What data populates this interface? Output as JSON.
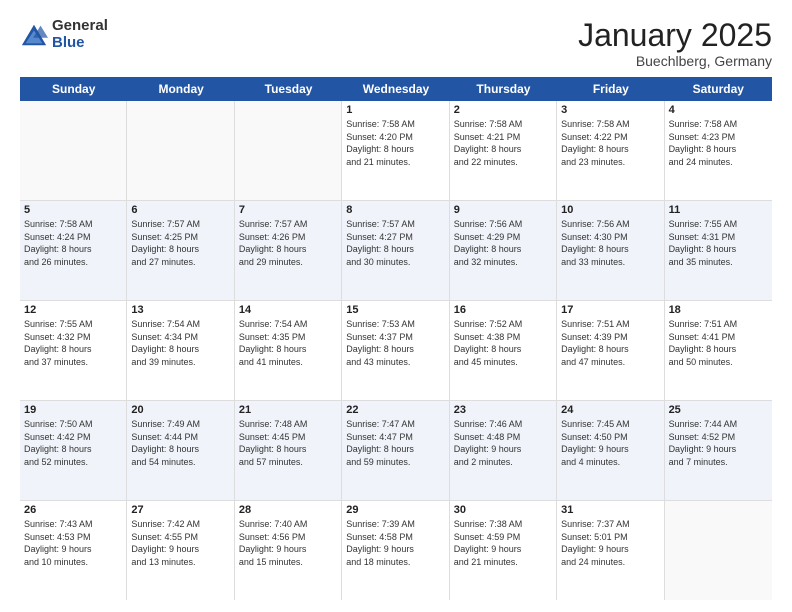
{
  "logo": {
    "general": "General",
    "blue": "Blue"
  },
  "title": "January 2025",
  "location": "Buechlberg, Germany",
  "header_days": [
    "Sunday",
    "Monday",
    "Tuesday",
    "Wednesday",
    "Thursday",
    "Friday",
    "Saturday"
  ],
  "rows": [
    {
      "alt": false,
      "cells": [
        {
          "day": "",
          "info": ""
        },
        {
          "day": "",
          "info": ""
        },
        {
          "day": "",
          "info": ""
        },
        {
          "day": "1",
          "info": "Sunrise: 7:58 AM\nSunset: 4:20 PM\nDaylight: 8 hours\nand 21 minutes."
        },
        {
          "day": "2",
          "info": "Sunrise: 7:58 AM\nSunset: 4:21 PM\nDaylight: 8 hours\nand 22 minutes."
        },
        {
          "day": "3",
          "info": "Sunrise: 7:58 AM\nSunset: 4:22 PM\nDaylight: 8 hours\nand 23 minutes."
        },
        {
          "day": "4",
          "info": "Sunrise: 7:58 AM\nSunset: 4:23 PM\nDaylight: 8 hours\nand 24 minutes."
        }
      ]
    },
    {
      "alt": true,
      "cells": [
        {
          "day": "5",
          "info": "Sunrise: 7:58 AM\nSunset: 4:24 PM\nDaylight: 8 hours\nand 26 minutes."
        },
        {
          "day": "6",
          "info": "Sunrise: 7:57 AM\nSunset: 4:25 PM\nDaylight: 8 hours\nand 27 minutes."
        },
        {
          "day": "7",
          "info": "Sunrise: 7:57 AM\nSunset: 4:26 PM\nDaylight: 8 hours\nand 29 minutes."
        },
        {
          "day": "8",
          "info": "Sunrise: 7:57 AM\nSunset: 4:27 PM\nDaylight: 8 hours\nand 30 minutes."
        },
        {
          "day": "9",
          "info": "Sunrise: 7:56 AM\nSunset: 4:29 PM\nDaylight: 8 hours\nand 32 minutes."
        },
        {
          "day": "10",
          "info": "Sunrise: 7:56 AM\nSunset: 4:30 PM\nDaylight: 8 hours\nand 33 minutes."
        },
        {
          "day": "11",
          "info": "Sunrise: 7:55 AM\nSunset: 4:31 PM\nDaylight: 8 hours\nand 35 minutes."
        }
      ]
    },
    {
      "alt": false,
      "cells": [
        {
          "day": "12",
          "info": "Sunrise: 7:55 AM\nSunset: 4:32 PM\nDaylight: 8 hours\nand 37 minutes."
        },
        {
          "day": "13",
          "info": "Sunrise: 7:54 AM\nSunset: 4:34 PM\nDaylight: 8 hours\nand 39 minutes."
        },
        {
          "day": "14",
          "info": "Sunrise: 7:54 AM\nSunset: 4:35 PM\nDaylight: 8 hours\nand 41 minutes."
        },
        {
          "day": "15",
          "info": "Sunrise: 7:53 AM\nSunset: 4:37 PM\nDaylight: 8 hours\nand 43 minutes."
        },
        {
          "day": "16",
          "info": "Sunrise: 7:52 AM\nSunset: 4:38 PM\nDaylight: 8 hours\nand 45 minutes."
        },
        {
          "day": "17",
          "info": "Sunrise: 7:51 AM\nSunset: 4:39 PM\nDaylight: 8 hours\nand 47 minutes."
        },
        {
          "day": "18",
          "info": "Sunrise: 7:51 AM\nSunset: 4:41 PM\nDaylight: 8 hours\nand 50 minutes."
        }
      ]
    },
    {
      "alt": true,
      "cells": [
        {
          "day": "19",
          "info": "Sunrise: 7:50 AM\nSunset: 4:42 PM\nDaylight: 8 hours\nand 52 minutes."
        },
        {
          "day": "20",
          "info": "Sunrise: 7:49 AM\nSunset: 4:44 PM\nDaylight: 8 hours\nand 54 minutes."
        },
        {
          "day": "21",
          "info": "Sunrise: 7:48 AM\nSunset: 4:45 PM\nDaylight: 8 hours\nand 57 minutes."
        },
        {
          "day": "22",
          "info": "Sunrise: 7:47 AM\nSunset: 4:47 PM\nDaylight: 8 hours\nand 59 minutes."
        },
        {
          "day": "23",
          "info": "Sunrise: 7:46 AM\nSunset: 4:48 PM\nDaylight: 9 hours\nand 2 minutes."
        },
        {
          "day": "24",
          "info": "Sunrise: 7:45 AM\nSunset: 4:50 PM\nDaylight: 9 hours\nand 4 minutes."
        },
        {
          "day": "25",
          "info": "Sunrise: 7:44 AM\nSunset: 4:52 PM\nDaylight: 9 hours\nand 7 minutes."
        }
      ]
    },
    {
      "alt": false,
      "cells": [
        {
          "day": "26",
          "info": "Sunrise: 7:43 AM\nSunset: 4:53 PM\nDaylight: 9 hours\nand 10 minutes."
        },
        {
          "day": "27",
          "info": "Sunrise: 7:42 AM\nSunset: 4:55 PM\nDaylight: 9 hours\nand 13 minutes."
        },
        {
          "day": "28",
          "info": "Sunrise: 7:40 AM\nSunset: 4:56 PM\nDaylight: 9 hours\nand 15 minutes."
        },
        {
          "day": "29",
          "info": "Sunrise: 7:39 AM\nSunset: 4:58 PM\nDaylight: 9 hours\nand 18 minutes."
        },
        {
          "day": "30",
          "info": "Sunrise: 7:38 AM\nSunset: 4:59 PM\nDaylight: 9 hours\nand 21 minutes."
        },
        {
          "day": "31",
          "info": "Sunrise: 7:37 AM\nSunset: 5:01 PM\nDaylight: 9 hours\nand 24 minutes."
        },
        {
          "day": "",
          "info": ""
        }
      ]
    }
  ]
}
